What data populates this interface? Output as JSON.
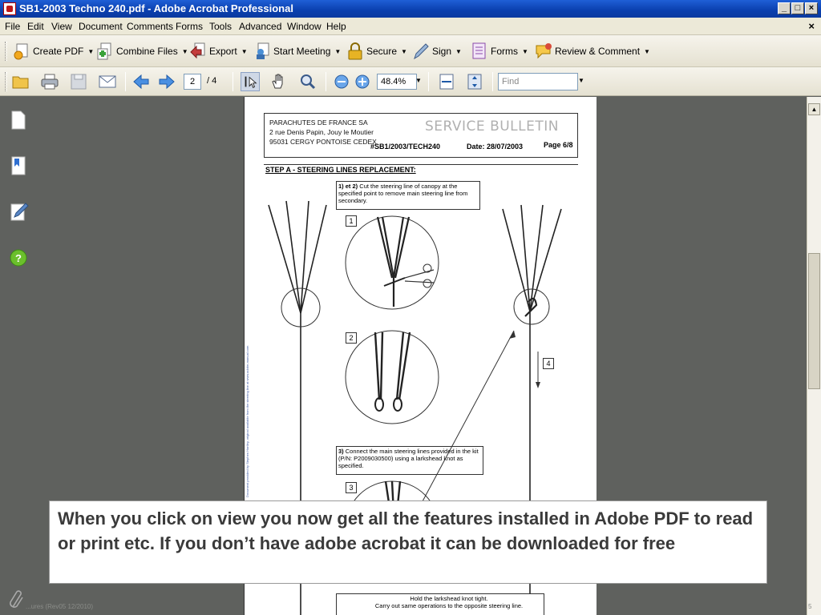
{
  "window": {
    "title": "SB1-2003 Techno 240.pdf - Adobe Acrobat Professional",
    "buttons": [
      "_",
      "□",
      "×"
    ]
  },
  "menubar": {
    "items": [
      "File",
      "Edit",
      "View",
      "Document",
      "Comments",
      "Forms",
      "Tools",
      "Advanced",
      "Window",
      "Help"
    ],
    "close_doc": "×"
  },
  "toolbar_tasks": {
    "create_pdf": "Create PDF",
    "combine_files": "Combine Files",
    "export": "Export",
    "start_meeting": "Start Meeting",
    "secure": "Secure",
    "sign": "Sign",
    "forms": "Forms",
    "review_comment": "Review & Comment"
  },
  "toolbar_nav": {
    "current_page": "2",
    "total_pages": "/ 4",
    "zoom": "48.4%",
    "find_placeholder": "Find"
  },
  "document": {
    "company": "PARACHUTES DE FRANCE SA",
    "address1": "2 rue Denis Papin, Jouy le Moutier",
    "address2": "95031 CERGY PONTOISE CEDEX",
    "bulletin_title": "SERVICE BULLETIN",
    "bulletin_number": "#SB1/2003/TECH240",
    "date": "Date: 28/07/2003",
    "page": "Page 6/8",
    "step_heading": "STEP A - STEERING LINES REPLACEMENT:",
    "note1_bold": "1) et 2)",
    "note1": " Cut the steering line of canopy at the specified point to remove main steering line from secondary.",
    "note3_bold": "3)",
    "note3": " Connect the main steering lines provided in the kit (P/N: P2009030500) using a larkshead knot as specified.",
    "note4_line1": "Hold the larkshead knot tight.",
    "note4_line2": "Carry out same operations to the opposite steering line.",
    "labels": [
      "1",
      "2",
      "3",
      "4",
      "4"
    ],
    "side_text": "Document provided by Stephen Hartley, original available from the steering line at www.adobe-manual.com"
  },
  "caption": {
    "text": "When you click on view you now get all the features installed in Adobe PDF to read or print etc. If you don’t have adobe acrobat it can be downloaded for free"
  },
  "footer": {
    "left": "...ures (Rev05 12/2010)",
    "right": "5"
  },
  "colors": {
    "titlebar": "#0a3fae",
    "chrome": "#ece9d8",
    "workspace": "#5f615e",
    "caption_text": "#3a3a3a"
  }
}
